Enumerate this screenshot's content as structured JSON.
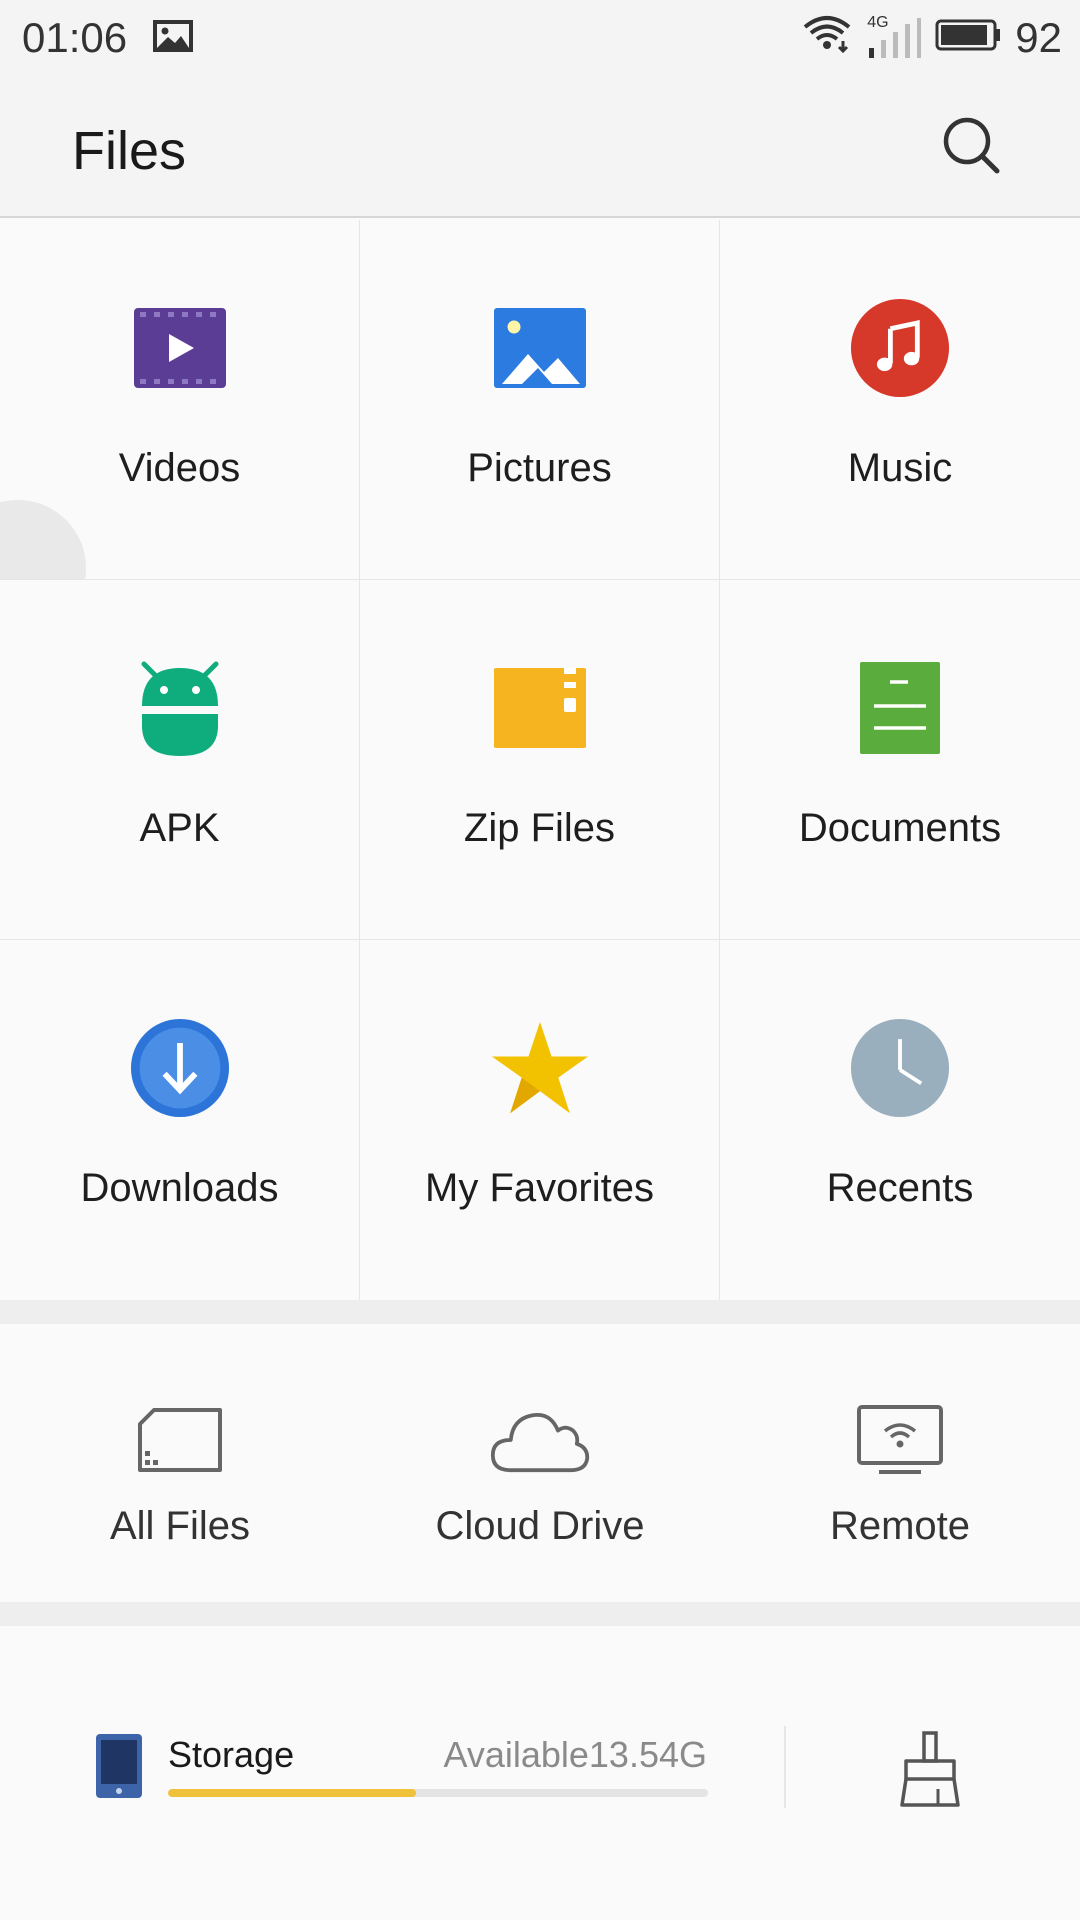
{
  "status_bar": {
    "time": "01:06",
    "network": "4G",
    "battery": "92",
    "battery_level": 0.92,
    "icons": [
      "image-notification-icon",
      "wifi-icon",
      "signal-icon",
      "battery-icon"
    ]
  },
  "header": {
    "title": "Files",
    "search_icon": "search-icon"
  },
  "categories": [
    {
      "label": "Videos",
      "icon": "video-icon",
      "color": "#5b3d96"
    },
    {
      "label": "Pictures",
      "icon": "picture-icon",
      "color": "#2b7be0"
    },
    {
      "label": "Music",
      "icon": "music-icon",
      "color": "#d6382a"
    },
    {
      "label": "APK",
      "icon": "android-icon",
      "color": "#0fad7e"
    },
    {
      "label": "Zip Files",
      "icon": "zip-icon",
      "color": "#f6b421"
    },
    {
      "label": "Documents",
      "icon": "document-icon",
      "color": "#5aac3c"
    },
    {
      "label": "Downloads",
      "icon": "download-icon",
      "color": "#2c74d8"
    },
    {
      "label": "My Favorites",
      "icon": "star-icon",
      "color": "#f2c200"
    },
    {
      "label": "Recents",
      "icon": "clock-icon",
      "color": "#9aafbe"
    }
  ],
  "quick_access": [
    {
      "label": "All Files",
      "icon": "sd-card-icon"
    },
    {
      "label": "Cloud Drive",
      "icon": "cloud-icon"
    },
    {
      "label": "Remote",
      "icon": "remote-monitor-icon"
    }
  ],
  "storage": {
    "label": "Storage",
    "available": "Available13.54G",
    "used_fraction": 0.46,
    "bar_color": "#f0c13a",
    "icon": "phone-icon",
    "clean_icon": "broom-icon"
  }
}
